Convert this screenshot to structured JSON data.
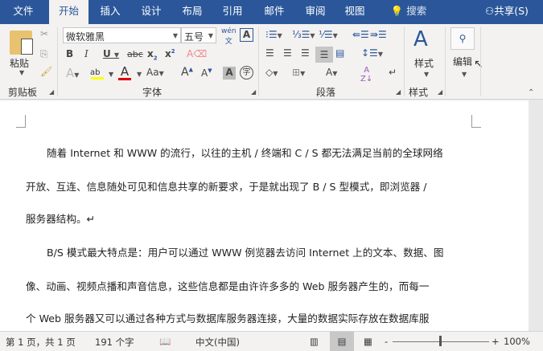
{
  "tabs": [
    "文件",
    "开始",
    "插入",
    "设计",
    "布局",
    "引用",
    "邮件",
    "审阅",
    "视图"
  ],
  "active_tab": "开始",
  "search": "搜索",
  "share": "共享(S)",
  "clipboard": {
    "paste": "粘贴",
    "group": "剪贴板"
  },
  "font": {
    "name": "微软雅黑",
    "size": "五号",
    "group": "字体",
    "colors": {
      "highlight": "#ffff00",
      "font_color": "#e00000"
    }
  },
  "paragraph": {
    "group": "段落"
  },
  "styles": {
    "label": "样式",
    "group": "样式"
  },
  "editing": {
    "label": "编辑"
  },
  "document": {
    "lines": [
      "随着 Internet 和 WWW 的流行，以往的主机 / 终端和 C / S 都无法满足当前的全球网络",
      "开放、互连、信息随处可见和信息共享的新要求，于是就出现了 B / S 型模式，即浏览器 /",
      "服务器结构。↵",
      "B/S 模式最大特点是：用户可以通过 WWW 例览器去访问 Internet 上的文本、数据、图",
      "像、动画、视频点播和声音信息，这些信息都是由许许多多的 Web 服务器产生的，而每一",
      "个 Web 服务器又可以通过各种方式与数据库服务器连接，大量的数据实际存放在数据库服"
    ]
  },
  "status": {
    "page": "第 1 页，共 1 页",
    "words": "191 个字",
    "language": "中文(中国)",
    "zoom": "100%"
  }
}
